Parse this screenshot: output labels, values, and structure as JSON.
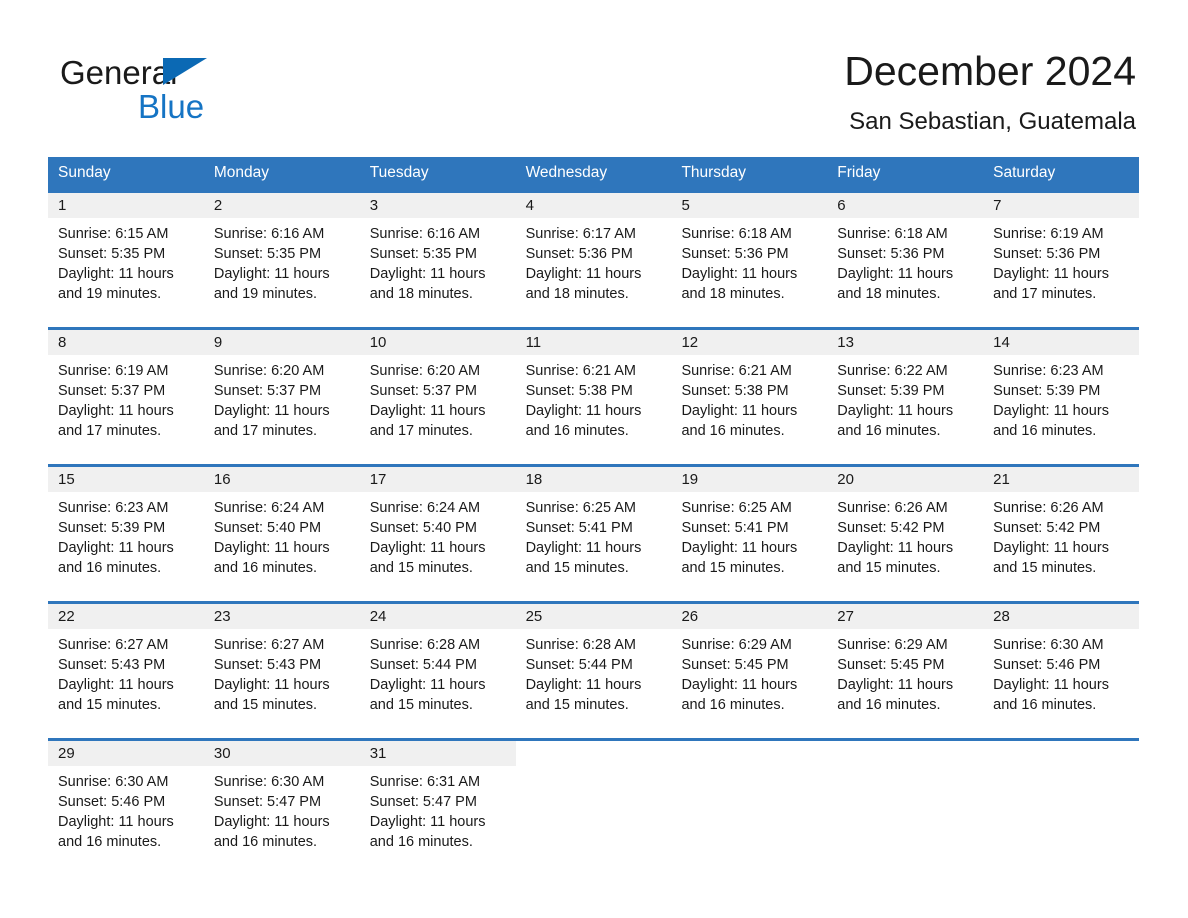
{
  "brand": {
    "name_part1": "General",
    "name_part2": "Blue",
    "flag_icon": "triangle-flag-icon"
  },
  "header": {
    "month_title": "December 2024",
    "location": "San Sebastian, Guatemala"
  },
  "colors": {
    "header_blue": "#2f76bc",
    "brand_blue": "#1574c4",
    "day_band_gray": "#f0f0f0",
    "text": "#1a1a1a"
  },
  "calendar": {
    "weekdays": [
      "Sunday",
      "Monday",
      "Tuesday",
      "Wednesday",
      "Thursday",
      "Friday",
      "Saturday"
    ],
    "weeks": [
      [
        {
          "day": "1",
          "sunrise": "Sunrise: 6:15 AM",
          "sunset": "Sunset: 5:35 PM",
          "daylight": "Daylight: 11 hours and 19 minutes."
        },
        {
          "day": "2",
          "sunrise": "Sunrise: 6:16 AM",
          "sunset": "Sunset: 5:35 PM",
          "daylight": "Daylight: 11 hours and 19 minutes."
        },
        {
          "day": "3",
          "sunrise": "Sunrise: 6:16 AM",
          "sunset": "Sunset: 5:35 PM",
          "daylight": "Daylight: 11 hours and 18 minutes."
        },
        {
          "day": "4",
          "sunrise": "Sunrise: 6:17 AM",
          "sunset": "Sunset: 5:36 PM",
          "daylight": "Daylight: 11 hours and 18 minutes."
        },
        {
          "day": "5",
          "sunrise": "Sunrise: 6:18 AM",
          "sunset": "Sunset: 5:36 PM",
          "daylight": "Daylight: 11 hours and 18 minutes."
        },
        {
          "day": "6",
          "sunrise": "Sunrise: 6:18 AM",
          "sunset": "Sunset: 5:36 PM",
          "daylight": "Daylight: 11 hours and 18 minutes."
        },
        {
          "day": "7",
          "sunrise": "Sunrise: 6:19 AM",
          "sunset": "Sunset: 5:36 PM",
          "daylight": "Daylight: 11 hours and 17 minutes."
        }
      ],
      [
        {
          "day": "8",
          "sunrise": "Sunrise: 6:19 AM",
          "sunset": "Sunset: 5:37 PM",
          "daylight": "Daylight: 11 hours and 17 minutes."
        },
        {
          "day": "9",
          "sunrise": "Sunrise: 6:20 AM",
          "sunset": "Sunset: 5:37 PM",
          "daylight": "Daylight: 11 hours and 17 minutes."
        },
        {
          "day": "10",
          "sunrise": "Sunrise: 6:20 AM",
          "sunset": "Sunset: 5:37 PM",
          "daylight": "Daylight: 11 hours and 17 minutes."
        },
        {
          "day": "11",
          "sunrise": "Sunrise: 6:21 AM",
          "sunset": "Sunset: 5:38 PM",
          "daylight": "Daylight: 11 hours and 16 minutes."
        },
        {
          "day": "12",
          "sunrise": "Sunrise: 6:21 AM",
          "sunset": "Sunset: 5:38 PM",
          "daylight": "Daylight: 11 hours and 16 minutes."
        },
        {
          "day": "13",
          "sunrise": "Sunrise: 6:22 AM",
          "sunset": "Sunset: 5:39 PM",
          "daylight": "Daylight: 11 hours and 16 minutes."
        },
        {
          "day": "14",
          "sunrise": "Sunrise: 6:23 AM",
          "sunset": "Sunset: 5:39 PM",
          "daylight": "Daylight: 11 hours and 16 minutes."
        }
      ],
      [
        {
          "day": "15",
          "sunrise": "Sunrise: 6:23 AM",
          "sunset": "Sunset: 5:39 PM",
          "daylight": "Daylight: 11 hours and 16 minutes."
        },
        {
          "day": "16",
          "sunrise": "Sunrise: 6:24 AM",
          "sunset": "Sunset: 5:40 PM",
          "daylight": "Daylight: 11 hours and 16 minutes."
        },
        {
          "day": "17",
          "sunrise": "Sunrise: 6:24 AM",
          "sunset": "Sunset: 5:40 PM",
          "daylight": "Daylight: 11 hours and 15 minutes."
        },
        {
          "day": "18",
          "sunrise": "Sunrise: 6:25 AM",
          "sunset": "Sunset: 5:41 PM",
          "daylight": "Daylight: 11 hours and 15 minutes."
        },
        {
          "day": "19",
          "sunrise": "Sunrise: 6:25 AM",
          "sunset": "Sunset: 5:41 PM",
          "daylight": "Daylight: 11 hours and 15 minutes."
        },
        {
          "day": "20",
          "sunrise": "Sunrise: 6:26 AM",
          "sunset": "Sunset: 5:42 PM",
          "daylight": "Daylight: 11 hours and 15 minutes."
        },
        {
          "day": "21",
          "sunrise": "Sunrise: 6:26 AM",
          "sunset": "Sunset: 5:42 PM",
          "daylight": "Daylight: 11 hours and 15 minutes."
        }
      ],
      [
        {
          "day": "22",
          "sunrise": "Sunrise: 6:27 AM",
          "sunset": "Sunset: 5:43 PM",
          "daylight": "Daylight: 11 hours and 15 minutes."
        },
        {
          "day": "23",
          "sunrise": "Sunrise: 6:27 AM",
          "sunset": "Sunset: 5:43 PM",
          "daylight": "Daylight: 11 hours and 15 minutes."
        },
        {
          "day": "24",
          "sunrise": "Sunrise: 6:28 AM",
          "sunset": "Sunset: 5:44 PM",
          "daylight": "Daylight: 11 hours and 15 minutes."
        },
        {
          "day": "25",
          "sunrise": "Sunrise: 6:28 AM",
          "sunset": "Sunset: 5:44 PM",
          "daylight": "Daylight: 11 hours and 15 minutes."
        },
        {
          "day": "26",
          "sunrise": "Sunrise: 6:29 AM",
          "sunset": "Sunset: 5:45 PM",
          "daylight": "Daylight: 11 hours and 16 minutes."
        },
        {
          "day": "27",
          "sunrise": "Sunrise: 6:29 AM",
          "sunset": "Sunset: 5:45 PM",
          "daylight": "Daylight: 11 hours and 16 minutes."
        },
        {
          "day": "28",
          "sunrise": "Sunrise: 6:30 AM",
          "sunset": "Sunset: 5:46 PM",
          "daylight": "Daylight: 11 hours and 16 minutes."
        }
      ],
      [
        {
          "day": "29",
          "sunrise": "Sunrise: 6:30 AM",
          "sunset": "Sunset: 5:46 PM",
          "daylight": "Daylight: 11 hours and 16 minutes."
        },
        {
          "day": "30",
          "sunrise": "Sunrise: 6:30 AM",
          "sunset": "Sunset: 5:47 PM",
          "daylight": "Daylight: 11 hours and 16 minutes."
        },
        {
          "day": "31",
          "sunrise": "Sunrise: 6:31 AM",
          "sunset": "Sunset: 5:47 PM",
          "daylight": "Daylight: 11 hours and 16 minutes."
        },
        {
          "day": "",
          "sunrise": "",
          "sunset": "",
          "daylight": ""
        },
        {
          "day": "",
          "sunrise": "",
          "sunset": "",
          "daylight": ""
        },
        {
          "day": "",
          "sunrise": "",
          "sunset": "",
          "daylight": ""
        },
        {
          "day": "",
          "sunrise": "",
          "sunset": "",
          "daylight": ""
        }
      ]
    ]
  }
}
